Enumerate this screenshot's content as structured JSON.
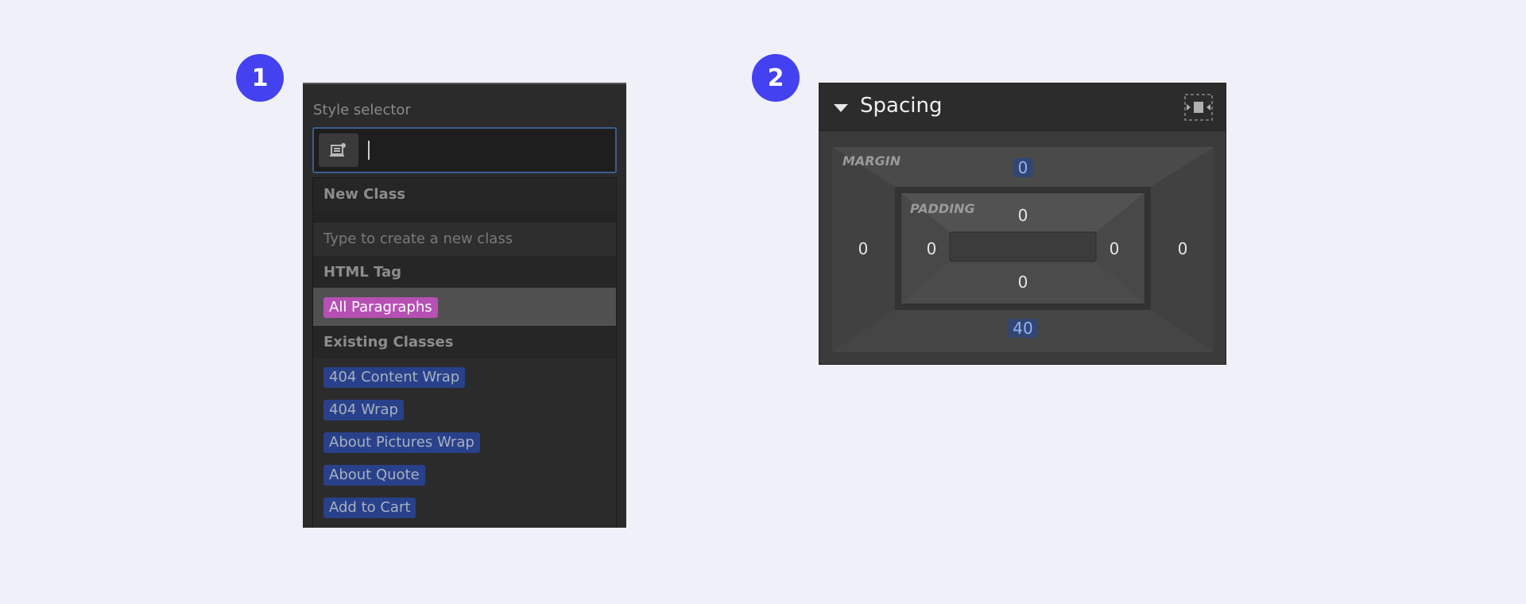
{
  "steps": [
    "1",
    "2"
  ],
  "style_selector": {
    "label": "Style selector",
    "input_value": "",
    "dropdown": {
      "new_class": {
        "header": "New Class",
        "placeholder": "Type to create a new class"
      },
      "html_tag": {
        "header": "HTML Tag",
        "selected": "All Paragraphs"
      },
      "existing_classes": {
        "header": "Existing Classes",
        "items": [
          "404 Content Wrap",
          "404 Wrap",
          "About Pictures Wrap",
          "About Quote",
          "Add to Cart"
        ]
      }
    }
  },
  "spacing": {
    "title": "Spacing",
    "margin": {
      "label": "MARGIN",
      "top": "0",
      "right": "0",
      "bottom": "40",
      "left": "0"
    },
    "padding": {
      "label": "PADDING",
      "top": "0",
      "right": "0",
      "bottom": "0",
      "left": "0"
    }
  },
  "colors": {
    "badge": "#4341f0",
    "tag_pink": "#b650b4",
    "tag_blue": "#28418a",
    "accent_value": "#8fb3ff"
  },
  "icons": {
    "selector": "selector-state-icon",
    "collapse": "triangle-down-icon",
    "expand": "expand-spacing-icon"
  }
}
